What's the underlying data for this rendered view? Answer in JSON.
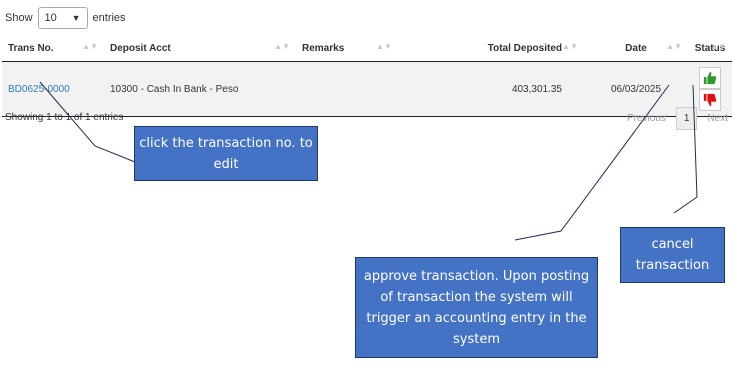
{
  "length_menu": {
    "show_label": "Show",
    "selected": "10",
    "suffix": "entries"
  },
  "table": {
    "headers": [
      "Trans No.",
      "Deposit Acct",
      "Remarks",
      "Total Deposited",
      "Date",
      "Status"
    ],
    "rows": [
      {
        "trans_no": "BD0625-0000",
        "deposit_acct": "10300 - Cash In Bank - Peso",
        "remarks": "",
        "total_deposited": "403,301.35",
        "date": "06/03/2025"
      }
    ]
  },
  "info_text": "Showing 1 to 1 of 1 entries",
  "pagination": {
    "previous": "Previous",
    "current": "1",
    "next": "Next"
  },
  "annotations": {
    "edit": "click the transaction no. to edit",
    "approve": "approve transaction. Upon posting of transaction the system will trigger an accounting entry in the system",
    "cancel": "cancel transaction"
  },
  "colors": {
    "link": "#2f7bc4",
    "approve_icon": "#2e9a2e",
    "cancel_icon": "#e01010",
    "callout_fill": "#4472c4"
  },
  "icons": {
    "approve": "thumbs-up-icon",
    "cancel": "thumbs-down-icon"
  }
}
